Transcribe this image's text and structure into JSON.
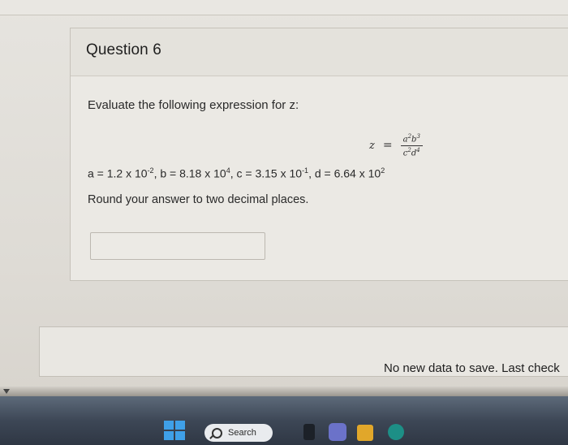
{
  "question": {
    "title": "Question 6",
    "prompt": "Evaluate the following expression for z:",
    "formula": {
      "lhs": "z",
      "eq": "=",
      "numerator_a": "a",
      "numerator_a_exp": "2",
      "numerator_b": "b",
      "numerator_b_exp": "3",
      "denominator_c": "c",
      "denominator_c_exp": "2",
      "denominator_d": "d",
      "denominator_d_exp": "4"
    },
    "values": {
      "a_prefix": "a = 1.2 x 10",
      "a_exp": "-2",
      "b_prefix": ", b = 8.18 x 10",
      "b_exp": "4",
      "c_prefix": ", c = 3.15 x 10",
      "c_exp": "-1",
      "d_prefix": ", d = 6.64 x 10",
      "d_exp": "2"
    },
    "instruction": "Round your answer to two decimal places.",
    "answer": {
      "value": "",
      "placeholder": ""
    }
  },
  "status": {
    "save_message": "No new data to save. Last check"
  },
  "taskbar": {
    "search_label": "Search",
    "icons": [
      "windows-start-icon",
      "search-icon",
      "task-view-icon",
      "teams-icon",
      "file-explorer-icon",
      "edge-icon"
    ]
  },
  "colors": {
    "card_background": "#ebe9e4",
    "taskbar": "#3d4756",
    "windows_accent": "#3fa0e8"
  }
}
